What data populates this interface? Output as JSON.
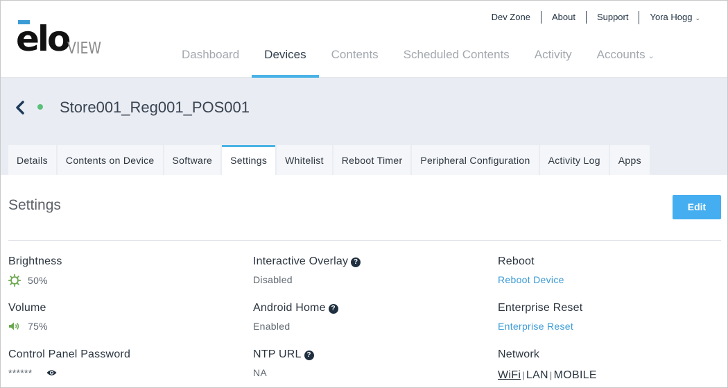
{
  "logo": {
    "brand": "elo",
    "product": "VIEW"
  },
  "top_links": [
    {
      "label": "Dev Zone"
    },
    {
      "label": "About"
    },
    {
      "label": "Support"
    },
    {
      "label": "Yora Hogg",
      "dropdown": true
    }
  ],
  "nav": [
    {
      "label": "Dashboard",
      "active": false
    },
    {
      "label": "Devices",
      "active": true
    },
    {
      "label": "Contents",
      "active": false
    },
    {
      "label": "Scheduled Contents",
      "active": false
    },
    {
      "label": "Activity",
      "active": false
    },
    {
      "label": "Accounts",
      "active": false,
      "dropdown": true
    }
  ],
  "device": {
    "name": "Store001_Reg001_POS001",
    "status_color": "#5cc07a"
  },
  "tabs": [
    {
      "label": "Details",
      "active": false
    },
    {
      "label": "Contents on Device",
      "active": false
    },
    {
      "label": "Software",
      "active": false
    },
    {
      "label": "Settings",
      "active": true
    },
    {
      "label": "Whitelist",
      "active": false
    },
    {
      "label": "Reboot Timer",
      "active": false
    },
    {
      "label": "Peripheral Configuration",
      "active": false
    },
    {
      "label": "Activity Log",
      "active": false
    },
    {
      "label": "Apps",
      "active": false
    }
  ],
  "settings": {
    "title": "Settings",
    "edit_label": "Edit",
    "brightness": {
      "label": "Brightness",
      "value": "50%",
      "icon": "brightness-icon"
    },
    "volume": {
      "label": "Volume",
      "value": "75%",
      "icon": "volume-icon"
    },
    "password": {
      "label": "Control Panel Password",
      "value": "******",
      "icon": "eye-icon"
    },
    "interactive_overlay": {
      "label": "Interactive Overlay",
      "value": "Disabled"
    },
    "android_home": {
      "label": "Android Home",
      "value": "Enabled"
    },
    "ntp_url": {
      "label": "NTP URL",
      "value": "NA"
    },
    "reboot": {
      "label": "Reboot",
      "action": "Reboot Device"
    },
    "enterprise_reset": {
      "label": "Enterprise Reset",
      "action": "Enterprise Reset"
    },
    "network": {
      "label": "Network",
      "options": [
        "WiFi",
        "LAN",
        "MOBILE"
      ],
      "selected": "WiFi"
    }
  },
  "colors": {
    "accent": "#4ab3e6",
    "button": "#45aef0",
    "link": "#3b9bd6",
    "icon_green": "#6aa84f"
  }
}
